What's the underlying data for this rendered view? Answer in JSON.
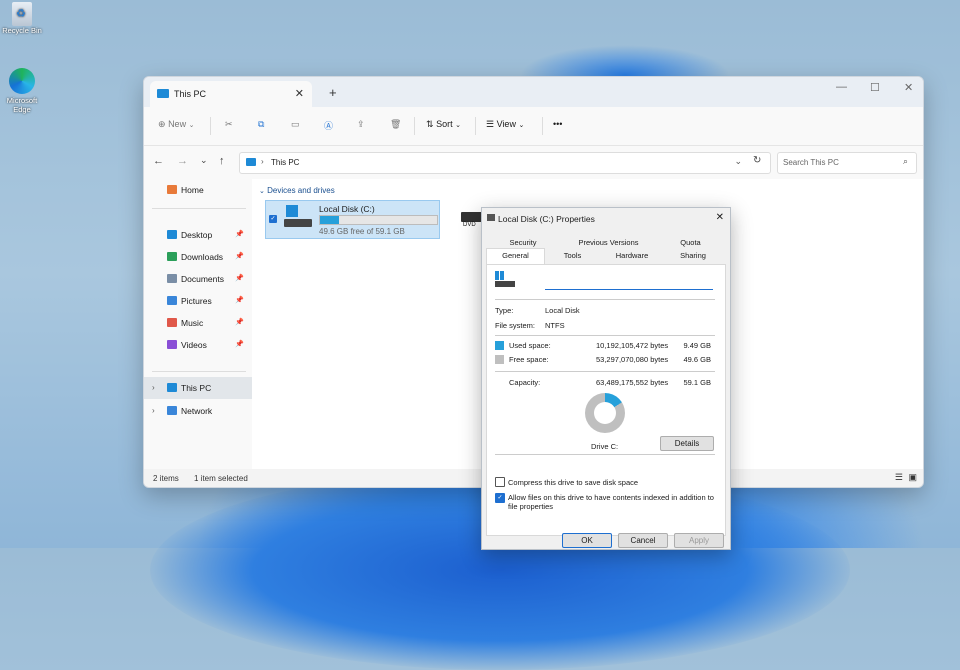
{
  "desktop": {
    "icons": [
      {
        "label": "Recycle Bin"
      },
      {
        "label": "Microsoft Edge"
      }
    ]
  },
  "window": {
    "tab_title": "This PC",
    "new_tab": "+",
    "controls": {
      "minimize": "—",
      "maximize": "☐",
      "close": "✕"
    }
  },
  "toolbar": {
    "new_label": "New",
    "sort_label": "Sort",
    "view_label": "View",
    "more_label": "•••"
  },
  "address": {
    "path": "This PC",
    "search_placeholder": "Search This PC"
  },
  "sidebar": {
    "home": "Home",
    "items": [
      {
        "label": "Desktop",
        "color": "#1e8ad6"
      },
      {
        "label": "Downloads",
        "color": "#2b9f5a"
      },
      {
        "label": "Documents",
        "color": "#7a8ea6"
      },
      {
        "label": "Pictures",
        "color": "#3a86d9"
      },
      {
        "label": "Music",
        "color": "#e0584a"
      },
      {
        "label": "Videos",
        "color": "#8a4fd6"
      }
    ],
    "this_pc": "This PC",
    "network": "Network"
  },
  "main": {
    "group_header": "Devices and drives",
    "drive": {
      "name": "Local Disk (C:)",
      "free_text": "49.6 GB free of 59.1 GB",
      "used_fraction": 0.16
    },
    "dvd_label": "DVD"
  },
  "statusbar": {
    "items": "2 items",
    "selected": "1 item selected"
  },
  "dialog": {
    "title": "Local Disk (C:) Properties",
    "tabs_top": [
      "Security",
      "Previous Versions",
      "Quota"
    ],
    "tabs_bottom": [
      "General",
      "Tools",
      "Hardware",
      "Sharing"
    ],
    "active_tab": "General",
    "name_value": "",
    "type_label": "Type:",
    "type_value": "Local Disk",
    "fs_label": "File system:",
    "fs_value": "NTFS",
    "used_label": "Used space:",
    "used_bytes": "10,192,105,472 bytes",
    "used_gb": "9.49 GB",
    "free_label": "Free space:",
    "free_bytes": "53,297,070,080 bytes",
    "free_gb": "49.6 GB",
    "capacity_label": "Capacity:",
    "capacity_bytes": "63,489,175,552 bytes",
    "capacity_gb": "59.1 GB",
    "drive_label": "Drive C:",
    "details_button": "Details",
    "compress_label": "Compress this drive to save disk space",
    "index_label": "Allow files on this drive to have contents indexed in addition to file properties",
    "ok": "OK",
    "cancel": "Cancel",
    "apply": "Apply",
    "colors": {
      "used": "#26a0da",
      "free": "#bfbfbf"
    }
  }
}
